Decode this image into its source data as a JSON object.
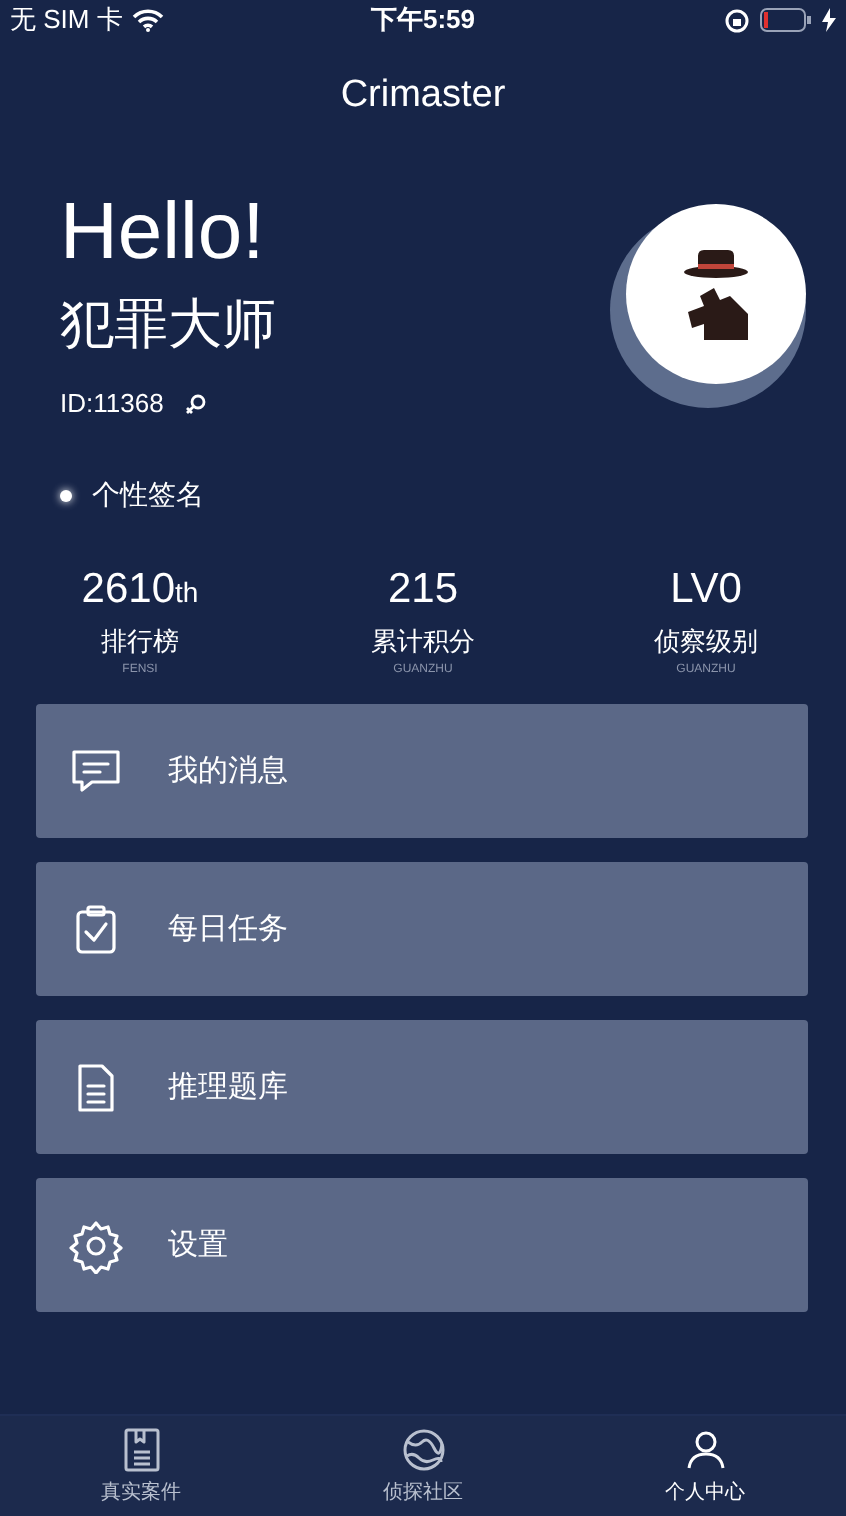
{
  "status_bar": {
    "carrier": "无 SIM 卡",
    "time": "下午5:59"
  },
  "nav": {
    "title": "Crimaster"
  },
  "profile": {
    "greeting": "Hello!",
    "name": "犯罪大师",
    "id": "ID:11368",
    "signature": "个性签名"
  },
  "stats": [
    {
      "value": "2610",
      "suffix": "th",
      "label": "排行榜",
      "sublabel": "FENSI"
    },
    {
      "value": "215",
      "label": "累计积分",
      "sublabel": "GUANZHU"
    },
    {
      "value": "LV0",
      "label": "侦察级别",
      "sublabel": "GUANZHU"
    }
  ],
  "menu": [
    {
      "kind": "message",
      "label": "我的消息"
    },
    {
      "kind": "task",
      "label": "每日任务"
    },
    {
      "kind": "document",
      "label": "推理题库"
    },
    {
      "kind": "settings",
      "label": "设置"
    }
  ],
  "tab_bar": [
    {
      "kind": "cases",
      "label": "真实案件",
      "selected": false
    },
    {
      "kind": "community",
      "label": "侦探社区",
      "selected": false
    },
    {
      "kind": "profile",
      "label": "个人中心",
      "selected": true
    }
  ]
}
